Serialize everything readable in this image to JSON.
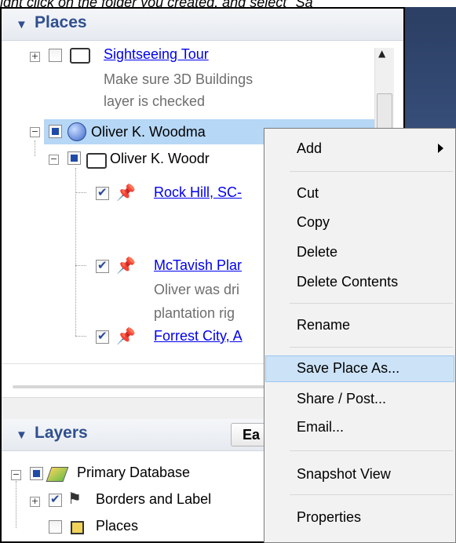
{
  "caption": "ight click on the folder you created, and select \"Sa",
  "places_panel": {
    "title": "Places",
    "items": [
      {
        "label": "Sightseeing Tour",
        "description": [
          "Make sure 3D Buildings",
          "layer is checked"
        ]
      },
      {
        "label": "Oliver K. Woodma"
      },
      {
        "label": "Oliver K. Woodr"
      },
      {
        "label": "Rock Hill, SC-"
      },
      {
        "label": "McTavish Plar",
        "description": [
          "Oliver was dri",
          "plantation rig"
        ]
      },
      {
        "label": "Forrest City, A"
      }
    ]
  },
  "layers_panel": {
    "title": "Layers",
    "earth_button": "Ea",
    "items": [
      {
        "label": "Primary Database"
      },
      {
        "label": "Borders and Label"
      },
      {
        "label": "Places"
      }
    ]
  },
  "context_menu": {
    "items": [
      {
        "label": "Add"
      },
      {
        "label": "Cut"
      },
      {
        "label": "Copy"
      },
      {
        "label": "Delete"
      },
      {
        "label": "Delete Contents"
      },
      {
        "label": "Rename"
      },
      {
        "label": "Save Place As..."
      },
      {
        "label": "Share / Post..."
      },
      {
        "label": "Email..."
      },
      {
        "label": "Snapshot View"
      },
      {
        "label": "Properties"
      }
    ]
  },
  "colors": {
    "header_text": "#2f4f8f",
    "selection": "#b6d7f5",
    "menu_highlight": "#cce3f7",
    "link": "#0000ee"
  }
}
